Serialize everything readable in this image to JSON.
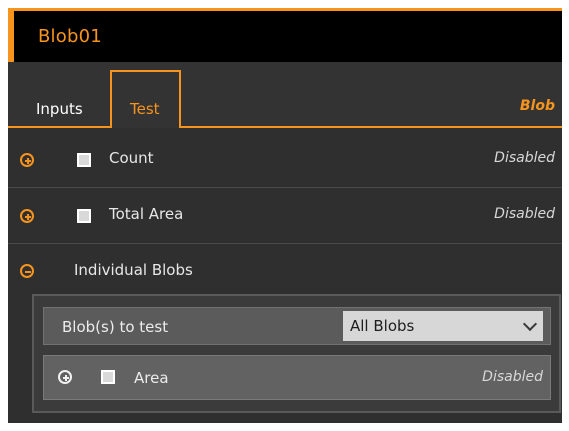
{
  "window": {
    "title": "Blob01"
  },
  "tabs": {
    "inputs": "Inputs",
    "test": "Test",
    "tool_type": "Blob"
  },
  "rows": {
    "count": {
      "label": "Count",
      "status": "Disabled",
      "expand_icon": "plus-circle-icon"
    },
    "total_area": {
      "label": "Total Area",
      "status": "Disabled",
      "expand_icon": "plus-circle-icon"
    },
    "individual_blobs": {
      "label": "Individual Blobs",
      "expand_icon": "minus-circle-icon"
    }
  },
  "individual_blobs": {
    "setting_label": "Blob(s) to test",
    "selected_value": "All Blobs",
    "area": {
      "label": "Area",
      "status": "Disabled",
      "expand_icon": "plus-circle-icon"
    }
  },
  "colors": {
    "accent": "#f7941e",
    "titlebar": "#000000",
    "panel": "#2f2f2f"
  }
}
